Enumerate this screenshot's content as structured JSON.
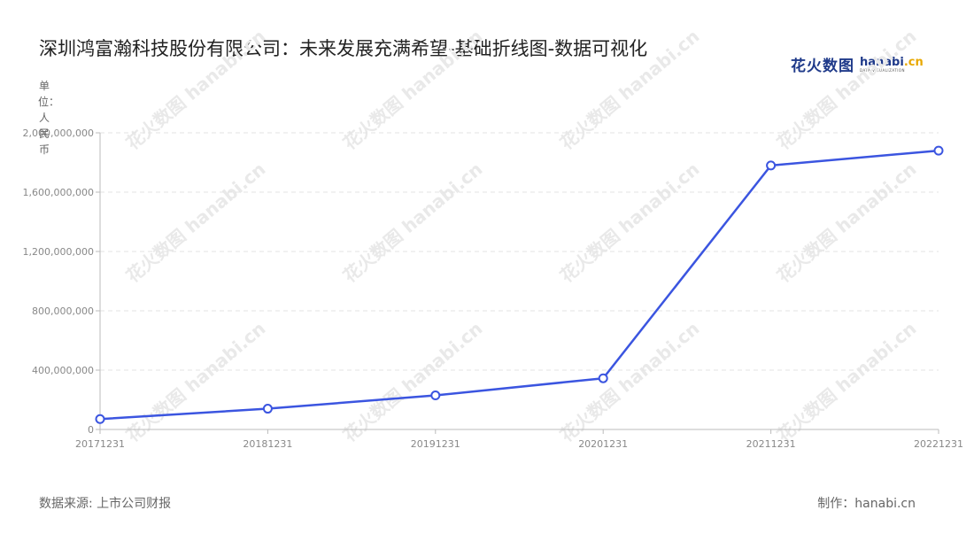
{
  "page": {
    "title": "深圳鸿富瀚科技股份有限公司：未来发展充满希望-基础折线图-数据可视化",
    "unit_label": "单位：人民币",
    "source": "数据来源: 上市公司财报",
    "credit": "制作：hanabi.cn",
    "logo": {
      "cn": "花火数图",
      "en_main": "hanabi",
      "en_accent": ".cn",
      "en_sub": "DATA VISUALIZATION"
    },
    "watermark": "花火数图 hanabi.cn"
  },
  "chart_data": {
    "type": "line",
    "title": "深圳鸿富瀚科技股份有限公司：未来发展充满希望-基础折线图-数据可视化",
    "xlabel": "",
    "ylabel": "单位：人民币",
    "categories": [
      "20171231",
      "20181231",
      "20191231",
      "20201231",
      "20211231",
      "20221231"
    ],
    "series": [
      {
        "values": [
          70000000,
          140000000,
          230000000,
          345000000,
          1780000000,
          1880000000
        ]
      }
    ],
    "ylim": [
      0,
      2000000000
    ],
    "yticks": [
      0,
      400000000,
      800000000,
      1200000000,
      1600000000,
      2000000000
    ],
    "ytick_labels": [
      "0",
      "400,000,000",
      "800,000,000",
      "1,200,000,000",
      "1,600,000,000",
      "2,000,000,000"
    ],
    "grid": true,
    "legend": "none",
    "colors": {
      "line": "#3b55e0",
      "marker_fill": "#ffffff",
      "grid": "#e3e3e3",
      "axis": "#bbbbbb"
    }
  }
}
